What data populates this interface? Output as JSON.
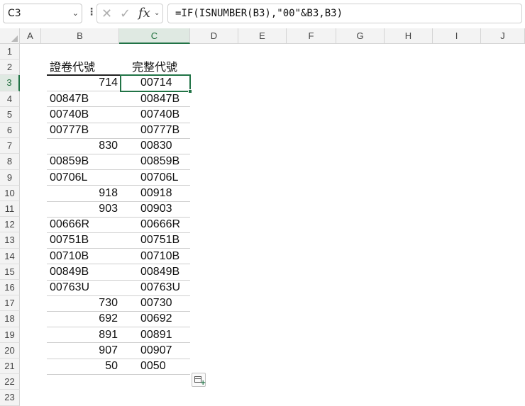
{
  "formula_bar": {
    "name_box": "C3",
    "name_box_arrow": "⌄",
    "separator": "⋮",
    "cancel_glyph": "✕",
    "enter_glyph": "✓",
    "fx_label": "fx",
    "fx_arrow": "⌄",
    "formula": "=IF(ISNUMBER(B3),\"00\"&B3,B3)"
  },
  "columns": [
    "A",
    "B",
    "C",
    "D",
    "E",
    "F",
    "G",
    "H",
    "I",
    "J"
  ],
  "rows": [
    "1",
    "2",
    "3",
    "4",
    "5",
    "6",
    "7",
    "8",
    "9",
    "10",
    "11",
    "12",
    "13",
    "14",
    "15",
    "16",
    "17",
    "18",
    "19",
    "20",
    "21",
    "22",
    "23"
  ],
  "selected_cell": "C3",
  "table": {
    "headers": [
      "證卷代號",
      "完整代號"
    ],
    "records": [
      {
        "code": "714",
        "full": "00714",
        "numeric": true
      },
      {
        "code": "00847B",
        "full": "00847B",
        "numeric": false
      },
      {
        "code": "00740B",
        "full": "00740B",
        "numeric": false
      },
      {
        "code": "00777B",
        "full": "00777B",
        "numeric": false
      },
      {
        "code": "830",
        "full": "00830",
        "numeric": true
      },
      {
        "code": "00859B",
        "full": "00859B",
        "numeric": false
      },
      {
        "code": "00706L",
        "full": "00706L",
        "numeric": false
      },
      {
        "code": "918",
        "full": "00918",
        "numeric": true
      },
      {
        "code": "903",
        "full": "00903",
        "numeric": true
      },
      {
        "code": "00666R",
        "full": "00666R",
        "numeric": false
      },
      {
        "code": "00751B",
        "full": "00751B",
        "numeric": false
      },
      {
        "code": "00710B",
        "full": "00710B",
        "numeric": false
      },
      {
        "code": "00849B",
        "full": "00849B",
        "numeric": false
      },
      {
        "code": "00763U",
        "full": "00763U",
        "numeric": false
      },
      {
        "code": "730",
        "full": "00730",
        "numeric": true
      },
      {
        "code": "692",
        "full": "00692",
        "numeric": true
      },
      {
        "code": "891",
        "full": "00891",
        "numeric": true
      },
      {
        "code": "907",
        "full": "00907",
        "numeric": true
      },
      {
        "code": "50",
        "full": "0050",
        "numeric": true
      }
    ]
  },
  "icons": {
    "quick_analysis": "quick-analysis-icon",
    "corner": "select-all-triangle-icon"
  },
  "colors": {
    "accent": "#217346",
    "header_bg": "#f3f3f3",
    "selected_header_bg": "#dfe9e2"
  }
}
